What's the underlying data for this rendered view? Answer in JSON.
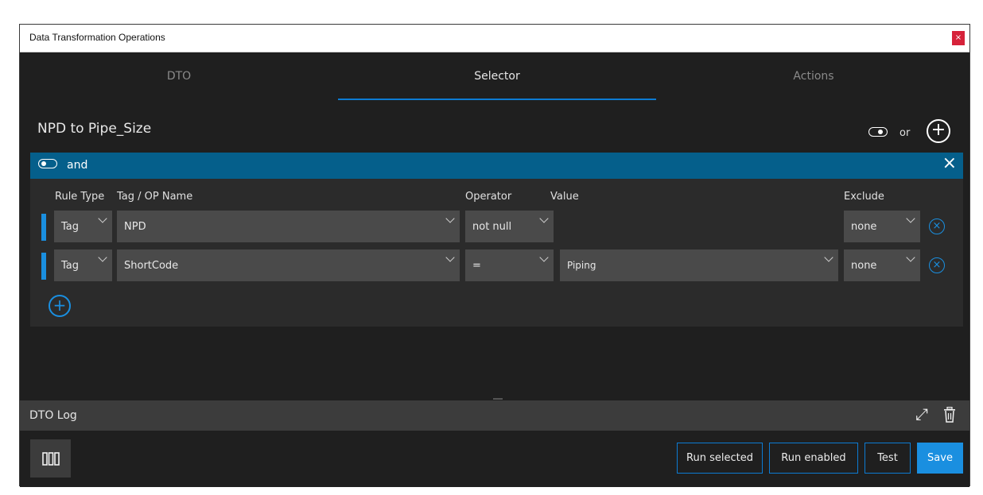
{
  "window": {
    "title": "Data Transformation Operations",
    "close_glyph": "×"
  },
  "tabs": [
    {
      "label": "DTO",
      "active": false
    },
    {
      "label": "Selector",
      "active": true
    },
    {
      "label": "Actions",
      "active": false
    }
  ],
  "selector": {
    "title": "NPD to Pipe_Size",
    "or_label": "or",
    "add_glyph": "+"
  },
  "group": {
    "and_label": "and",
    "close_glyph": "×",
    "columns": {
      "rule_type": "Rule Type",
      "tag_name": "Tag / OP Name",
      "operator": "Operator",
      "value": "Value",
      "exclude": "Exclude"
    },
    "rules": [
      {
        "rule_type": "Tag",
        "tag_name": "NPD",
        "operator": "not null",
        "value": "",
        "exclude": "none"
      },
      {
        "rule_type": "Tag",
        "tag_name": "ShortCode",
        "operator": "=",
        "value": "Piping",
        "exclude": "none"
      }
    ],
    "add_rule_glyph": "+",
    "remove_glyph": "×"
  },
  "log": {
    "label": "DTO Log",
    "expand_glyph": "⤢"
  },
  "footer": {
    "buttons": {
      "run_selected": "Run selected",
      "run_enabled": "Run enabled",
      "test": "Test",
      "save": "Save"
    }
  },
  "colors": {
    "accent": "#1a8fe0",
    "group_header": "#055f8b",
    "background": "#1f1f1f",
    "close_red": "#d6223a"
  }
}
